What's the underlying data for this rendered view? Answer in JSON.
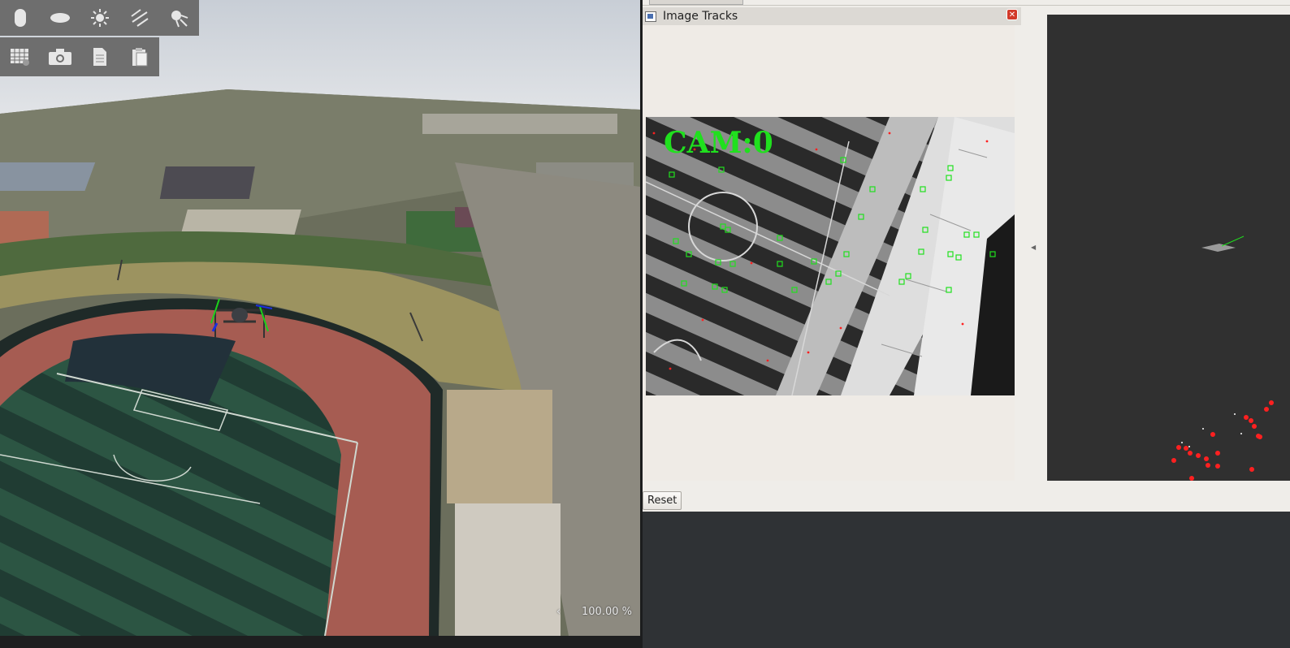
{
  "toolbar_top": {
    "tools": [
      {
        "name": "capsule-icon"
      },
      {
        "name": "disc-icon"
      },
      {
        "name": "sun-icon"
      },
      {
        "name": "lines-icon"
      },
      {
        "name": "spotlight-icon"
      }
    ]
  },
  "toolbar_bottom": {
    "tools": [
      {
        "name": "grid-icon"
      },
      {
        "name": "camera-icon"
      },
      {
        "name": "document-icon"
      },
      {
        "name": "clipboard-icon"
      }
    ]
  },
  "sim_view": {
    "zoom_arrow": "‹",
    "zoom_level": "100.00 %"
  },
  "image_tracks": {
    "title": "Image Tracks",
    "camera_label": "CAM:0"
  },
  "controls": {
    "reset_label": "Reset"
  },
  "colors": {
    "track_green": "#20e01e",
    "feature_red": "#ff2020",
    "rviz_bg": "#303030"
  }
}
